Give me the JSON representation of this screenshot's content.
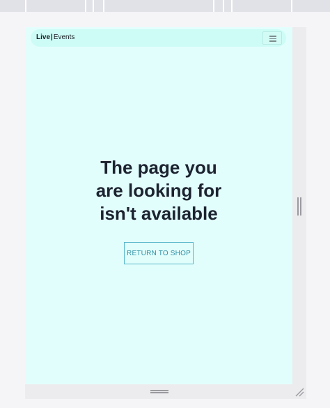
{
  "navbar": {
    "brand_primary": "Live",
    "brand_separator": "|",
    "brand_secondary": "Events",
    "menu_icon": "hamburger-menu-icon"
  },
  "main": {
    "heading_line1": "The page you",
    "heading_line2": "are looking for",
    "heading_line3": "isn't available",
    "return_button_label": "RETURN TO SHOP"
  },
  "colors": {
    "page_background": "#e2fefc",
    "navbar_background": "#cdfcf6",
    "button_border": "#56b6c8",
    "button_text": "#2c8ea3",
    "heading_text": "#1c2330"
  },
  "icons": {
    "right_resize": "vertical-resize-handle-icon",
    "bottom_resize": "horizontal-resize-handle-icon",
    "corner_resize": "corner-resize-grip-icon"
  }
}
